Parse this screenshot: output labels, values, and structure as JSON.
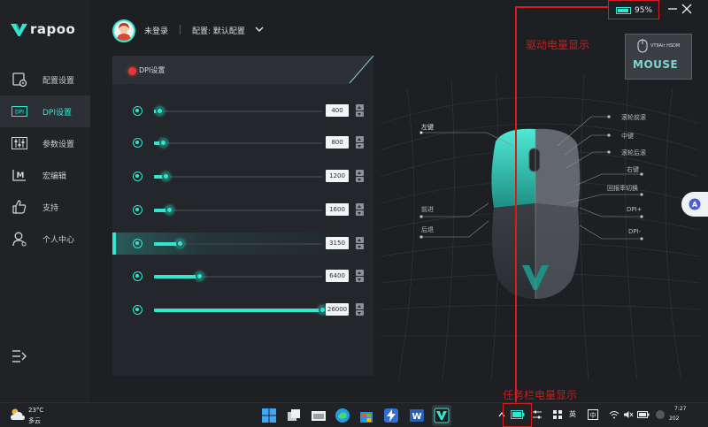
{
  "brand": {
    "name": "rapoo"
  },
  "colors": {
    "accent": "#33e6cf",
    "annotation": "#c81d1d",
    "battery": "#33e6cf"
  },
  "header": {
    "user_name": "未登录",
    "profile": "配置: 默认配置"
  },
  "battery": {
    "percent": "95%",
    "level": 0.95
  },
  "sidebar": {
    "items": [
      {
        "label": "配置设置",
        "icon": "profile-settings-icon",
        "active": false
      },
      {
        "label": "DPI设置",
        "icon": "dpi-icon",
        "active": true
      },
      {
        "label": "参数设置",
        "icon": "parameter-sliders-icon",
        "active": false
      },
      {
        "label": "宏编辑",
        "icon": "macro-icon",
        "active": false
      },
      {
        "label": "支持",
        "icon": "thumbs-up-icon",
        "active": false
      },
      {
        "label": "个人中心",
        "icon": "user-icon",
        "active": false
      }
    ]
  },
  "dpi_panel": {
    "title": "DPI设置",
    "rows": [
      {
        "value": "400",
        "level": 0.03,
        "active": false
      },
      {
        "value": "800",
        "level": 0.05,
        "active": false
      },
      {
        "value": "1200",
        "level": 0.07,
        "active": false
      },
      {
        "value": "1600",
        "level": 0.09,
        "active": false
      },
      {
        "value": "3150",
        "level": 0.15,
        "active": true
      },
      {
        "value": "6400",
        "level": 0.27,
        "active": false
      },
      {
        "value": "26000",
        "level": 1.0,
        "active": false
      }
    ]
  },
  "mouse_labels": {
    "left_button": "左键",
    "scroll_forward": "滚轮前滚",
    "middle": "中键",
    "scroll_back": "滚轮后滚",
    "right_button": "右键",
    "polling_switch": "回报率切换",
    "forward": "前进",
    "back": "后退",
    "dpi_plus": "DPI+",
    "dpi_minus": "DPI-"
  },
  "device_card": {
    "model": "VT9Air HSDM",
    "title": "MOUSE"
  },
  "annotations": {
    "driver_battery": "驱动电量显示",
    "taskbar_battery": "任务栏电量显示"
  },
  "taskbar": {
    "weather": {
      "temp": "23°C",
      "desc": "多云"
    },
    "apps": [
      "windows-start-icon",
      "task-view-icon",
      "edge-icon",
      "store-icon",
      "lightning-icon",
      "word-icon",
      "rapoo-app-icon"
    ],
    "tray": {
      "lang": "英",
      "clock_time": "7:27",
      "clock_date": "202"
    }
  }
}
